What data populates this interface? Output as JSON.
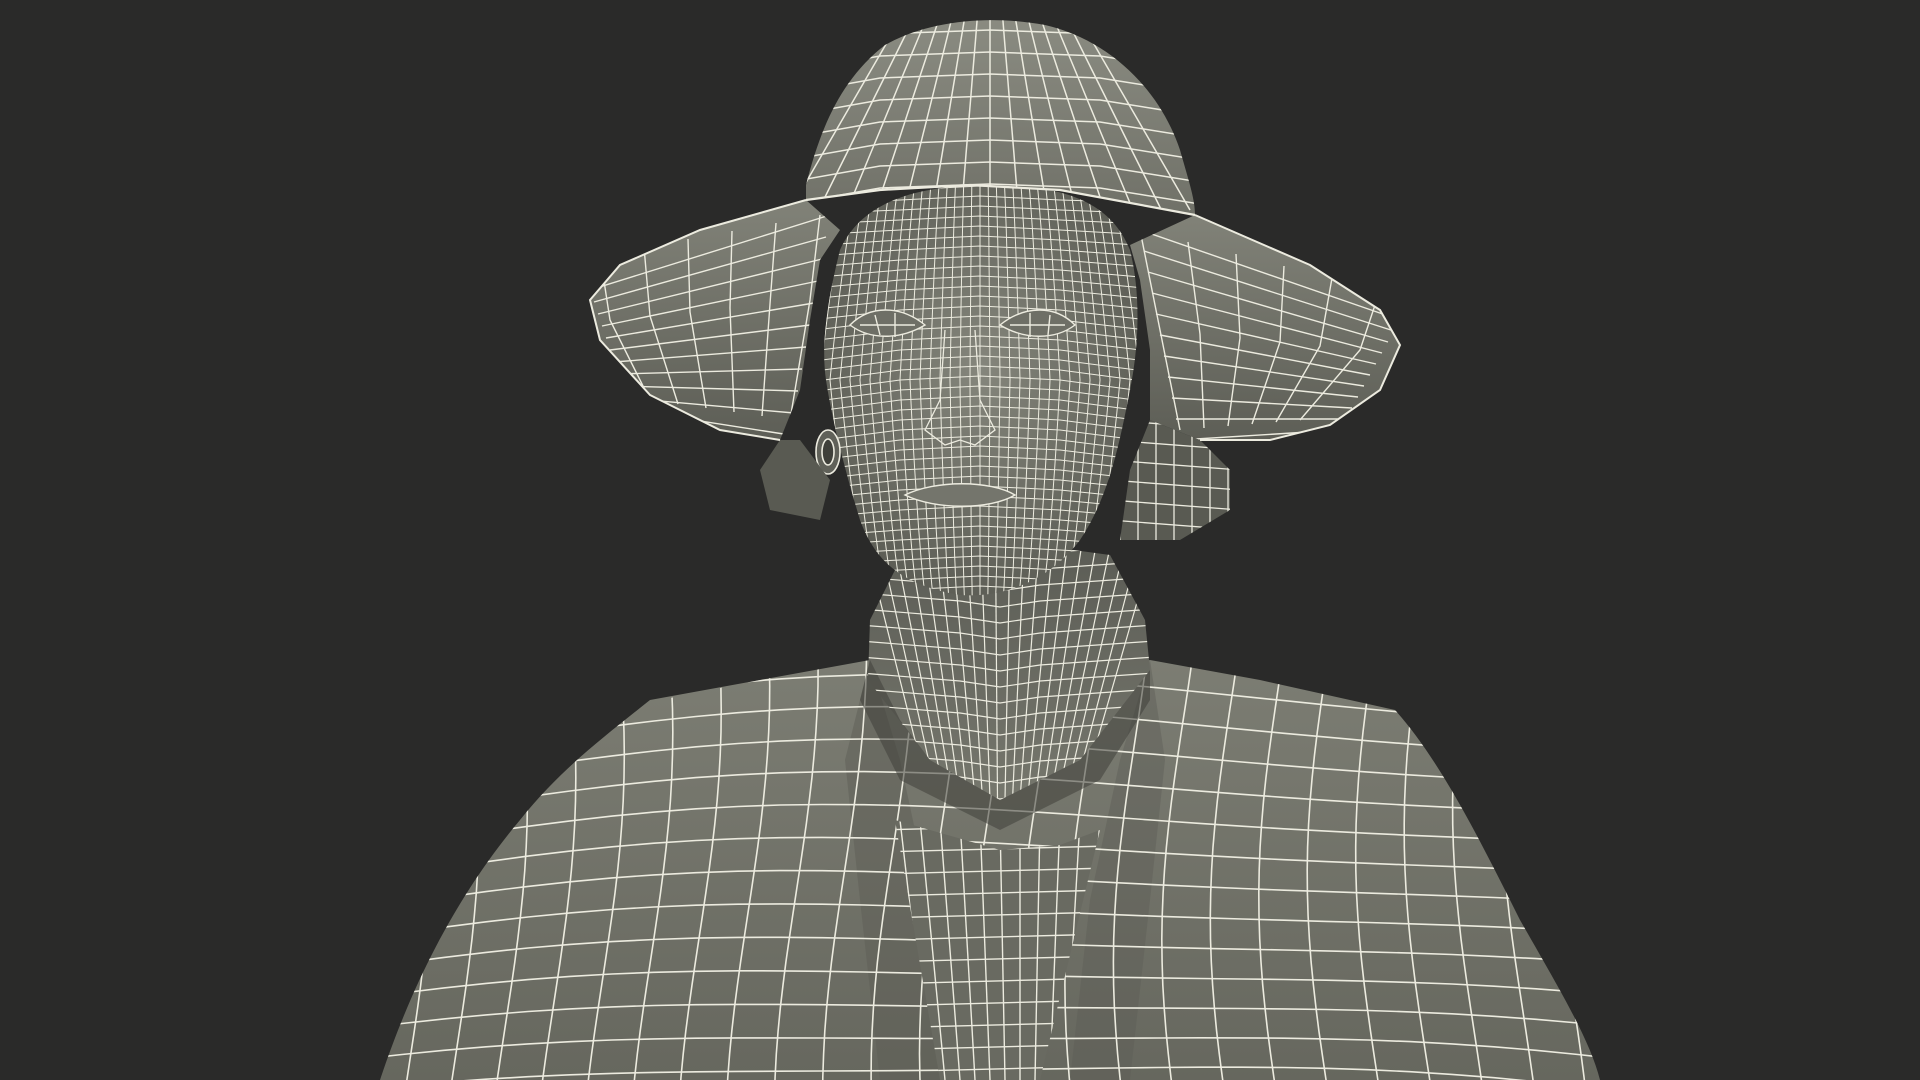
{
  "scene": {
    "subject": "wireframe-3d-model",
    "colors": {
      "background": "#2a2a29",
      "surface_light": "#7c7d73",
      "surface_mid": "#6b6c63",
      "surface_dark": "#4a4b45",
      "shadow": "#3a3b36",
      "wire": "#ecebdf"
    }
  }
}
